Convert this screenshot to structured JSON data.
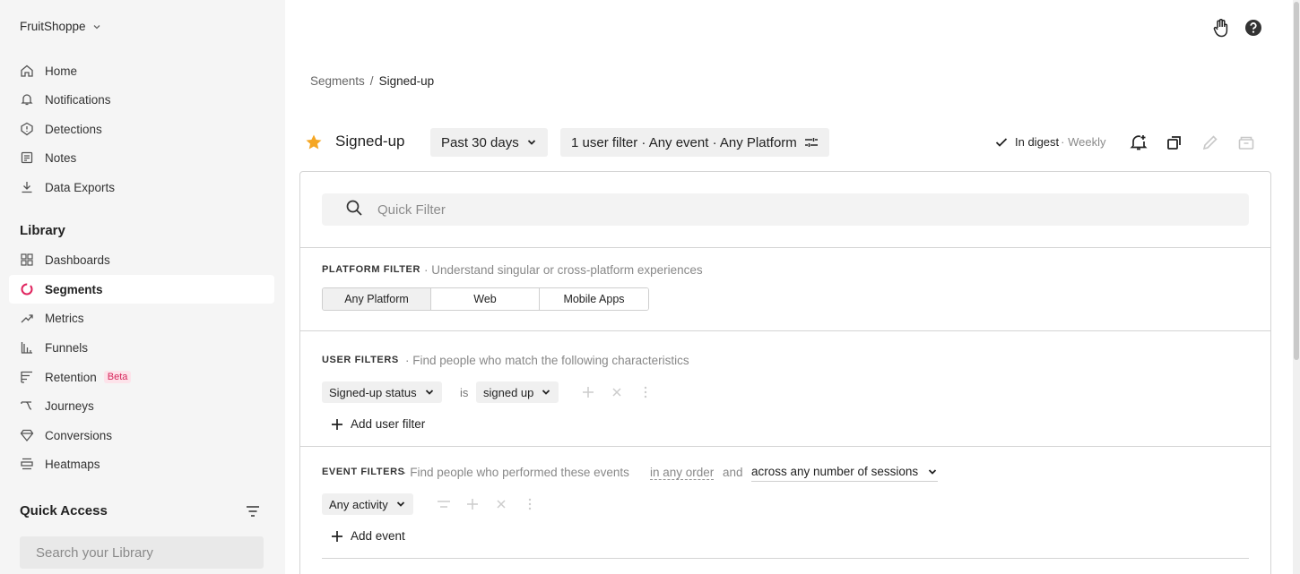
{
  "sidebar": {
    "org_name": "FruitShoppe",
    "top_items": [
      {
        "label": "Home",
        "icon": "home-icon"
      },
      {
        "label": "Notifications",
        "icon": "bell-icon"
      },
      {
        "label": "Detections",
        "icon": "shield-icon"
      },
      {
        "label": "Notes",
        "icon": "note-icon"
      },
      {
        "label": "Data Exports",
        "icon": "download-icon"
      }
    ],
    "library_title": "Library",
    "library_items": [
      {
        "label": "Dashboards",
        "icon": "grid-icon"
      },
      {
        "label": "Segments",
        "icon": "segment-ring-icon",
        "active": true
      },
      {
        "label": "Metrics",
        "icon": "trend-icon"
      },
      {
        "label": "Funnels",
        "icon": "funnel-bars-icon"
      },
      {
        "label": "Retention",
        "icon": "retention-icon",
        "badge": "Beta"
      },
      {
        "label": "Journeys",
        "icon": "journey-icon"
      },
      {
        "label": "Conversions",
        "icon": "diamond-icon"
      },
      {
        "label": "Heatmaps",
        "icon": "heatmap-icon"
      }
    ],
    "quick_access_title": "Quick Access",
    "search_placeholder": "Search your Library"
  },
  "breadcrumb": {
    "parent": "Segments",
    "separator": "/",
    "current": "Signed-up"
  },
  "header": {
    "title": "Signed-up",
    "date_range": "Past 30 days",
    "filter_summary": "1 user filter · Any event · Any Platform",
    "digest_label": "In digest",
    "digest_freq": "· Weekly"
  },
  "quick_filter": {
    "placeholder": "Quick Filter"
  },
  "platform_filter": {
    "heading": "PLATFORM FILTER",
    "description": "·  Understand singular or cross-platform experiences",
    "options": [
      "Any Platform",
      "Web",
      "Mobile Apps"
    ],
    "selected": "Any Platform"
  },
  "user_filters": {
    "heading": "USER FILTERS",
    "description": "·  Find people who match the following characteristics",
    "filter_field": "Signed-up status",
    "operator": "is",
    "filter_value": "signed up",
    "add_label": "Add user filter"
  },
  "event_filters": {
    "heading": "EVENT FILTERS",
    "description": "·  Find people who performed these events",
    "order_label": "in any order",
    "and_label": "and",
    "sessions_label": "across any number of sessions",
    "event_value": "Any activity",
    "add_label": "Add event"
  },
  "colors": {
    "accent_pink": "#e0245e",
    "star": "#f5a623",
    "sidebar_bg": "#f5f5f5"
  }
}
